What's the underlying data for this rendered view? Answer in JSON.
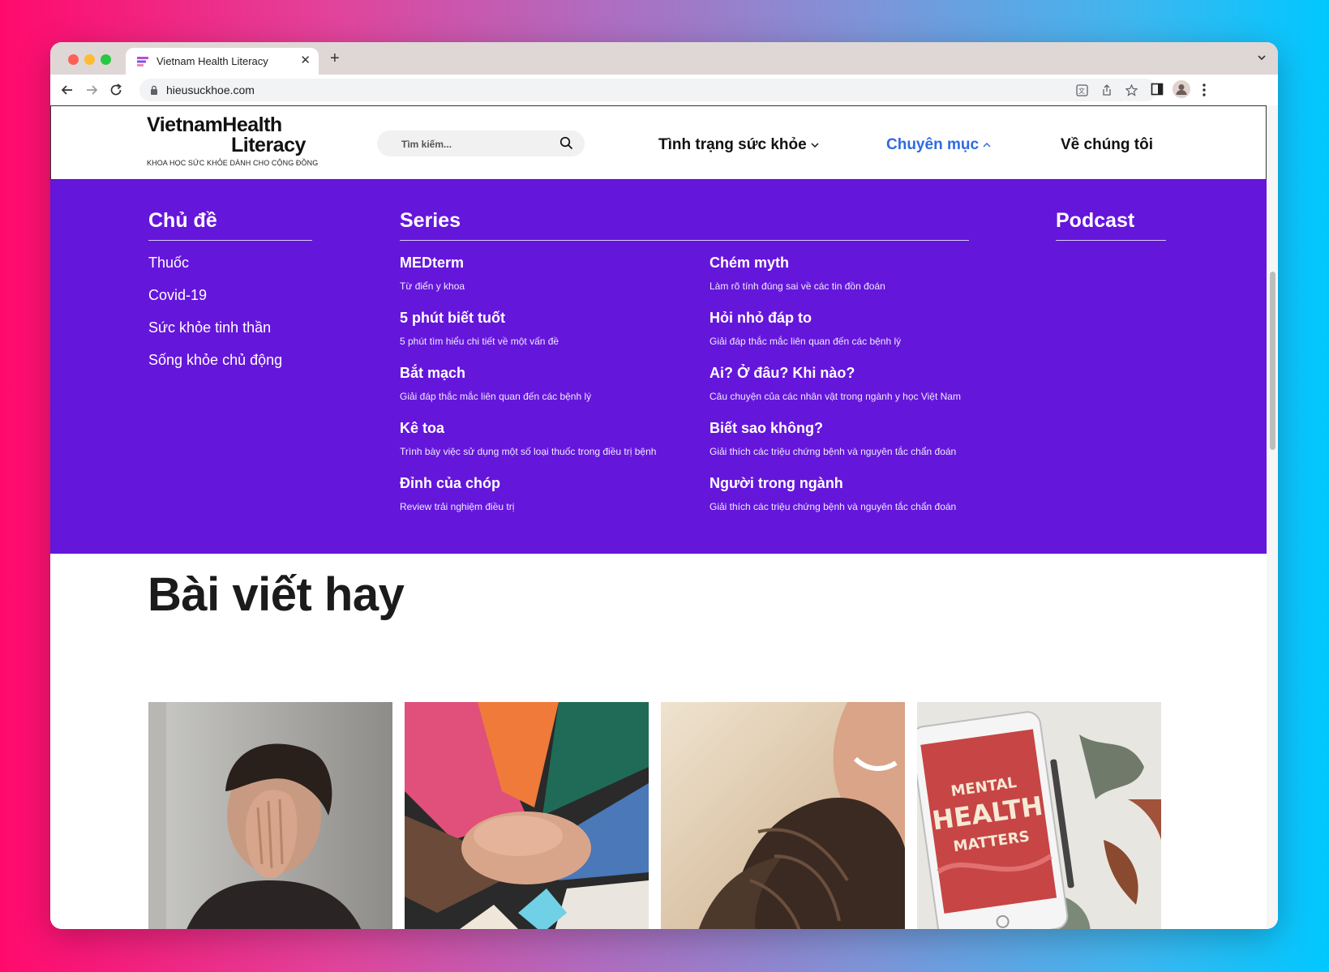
{
  "browser": {
    "tab_title": "Vietnam Health Literacy",
    "url": "hieusuckhoe.com"
  },
  "header": {
    "logo_line1": "VietnamHealth",
    "logo_line2": "Literacy",
    "logo_tagline": "KHOA HỌC SỨC KHỎE DÀNH CHO CỘNG ĐỒNG",
    "search_placeholder": "Tìm kiếm...",
    "nav": [
      {
        "label": "Tình trạng sức khỏe"
      },
      {
        "label": "Chuyên mục"
      },
      {
        "label": "Về chúng tôi"
      }
    ],
    "active_color": "#2f6be0"
  },
  "mega_menu": {
    "background": "#6516db",
    "topics_heading": "Chủ đề",
    "topics": [
      "Thuốc",
      "Covid-19",
      "Sức khỏe tinh thần",
      "Sống khỏe chủ động"
    ],
    "series_heading": "Series",
    "series": [
      {
        "title": "MEDterm",
        "desc": "Từ điển y khoa"
      },
      {
        "title": "Chém myth",
        "desc": "Làm rõ tính đúng sai về các tin đồn đoán"
      },
      {
        "title": "5 phút biết tuốt",
        "desc": "5 phút tìm hiểu chi tiết về một vấn đề"
      },
      {
        "title": "Hỏi nhỏ đáp to",
        "desc": "Giải đáp thắc mắc liên quan đến các bệnh lý"
      },
      {
        "title": "Bắt mạch",
        "desc": "Giải đáp thắc mắc liên quan đến các bệnh lý"
      },
      {
        "title": "Ai? Ở đâu? Khi nào?",
        "desc": "Câu chuyện của các nhân vật trong ngành y học Việt Nam"
      },
      {
        "title": "Kê toa",
        "desc": "Trình bày việc sử dụng một số loại thuốc trong điều trị bệnh"
      },
      {
        "title": "Biết sao không?",
        "desc": "Giải thích các triệu chứng bệnh và nguyên tắc chẩn đoán"
      },
      {
        "title": "Đỉnh của chóp",
        "desc": "Review trải nghiệm điều trị"
      },
      {
        "title": "Người trong ngành",
        "desc": "Giải thích các triệu chứng bệnh và nguyên tắc chẩn đoán"
      }
    ],
    "podcast_heading": "Podcast"
  },
  "articles": {
    "section_title": "Bài viết hay",
    "card4_text": [
      "MENTAL",
      "HEALTH",
      "MATTERS"
    ]
  }
}
